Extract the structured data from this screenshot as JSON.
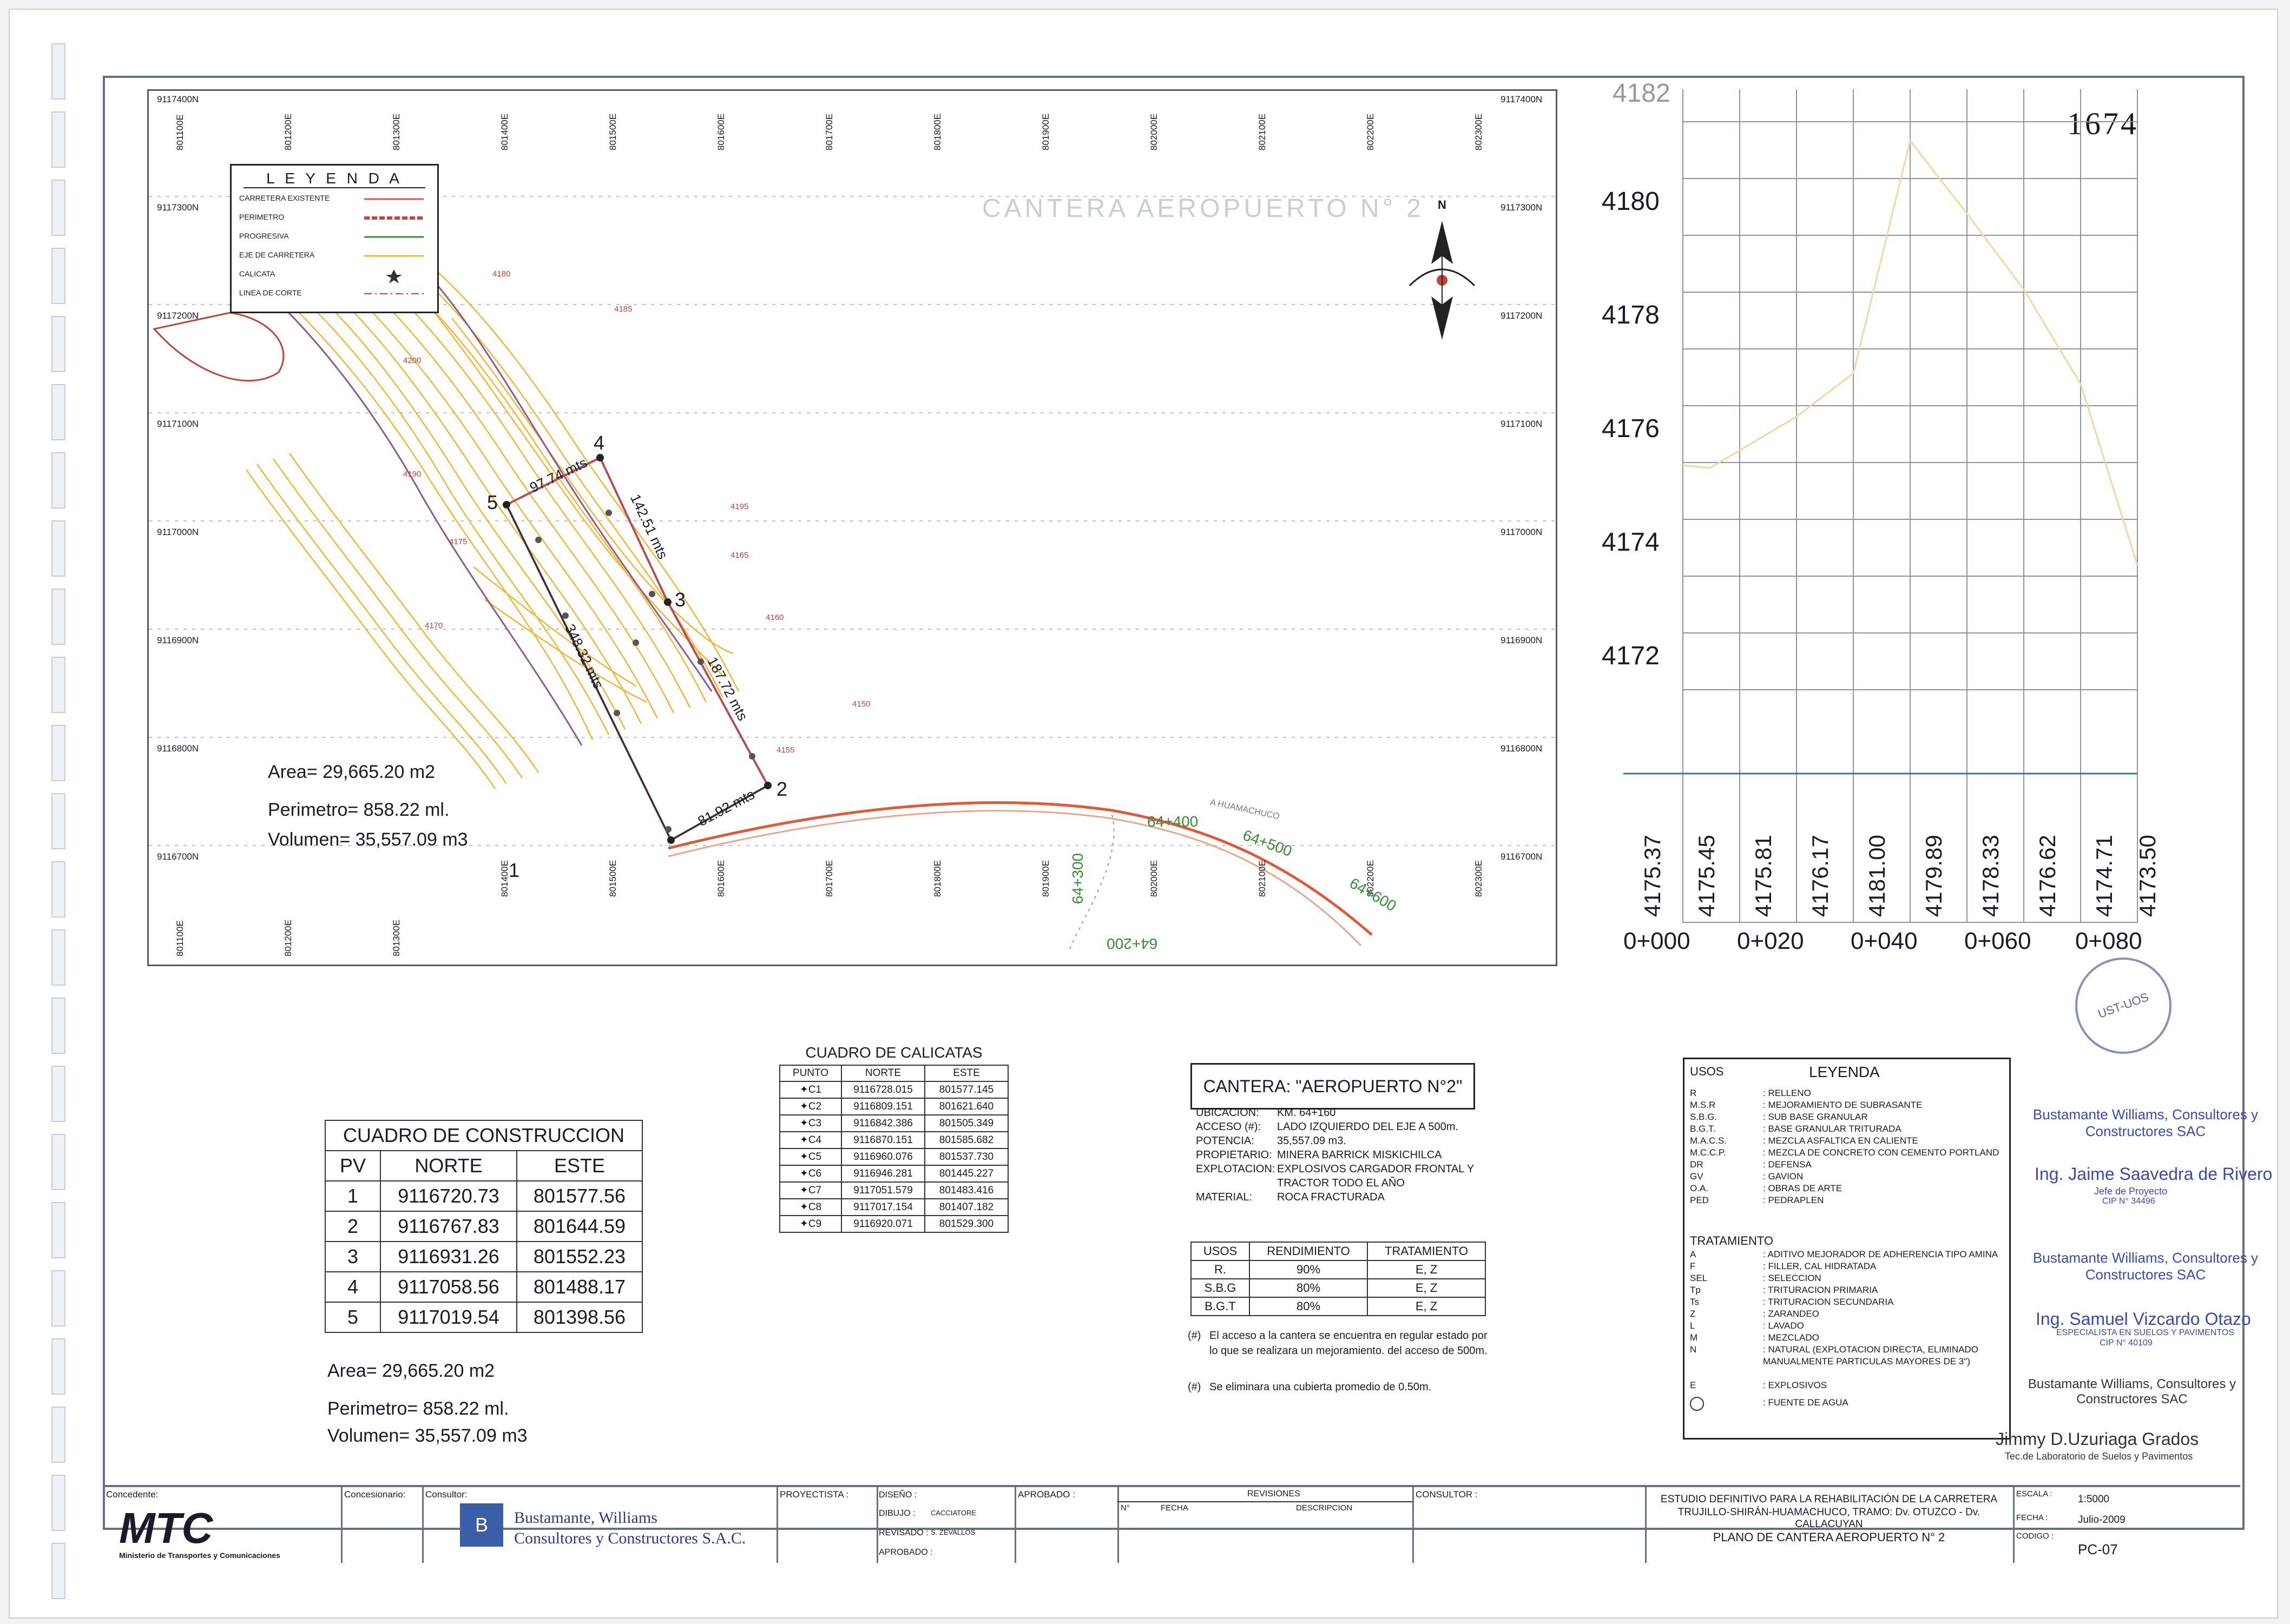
{
  "sheet_number": "1674",
  "map": {
    "title": "CANTERA AEROPUERTO N° 2",
    "north_label": "N",
    "top_coords": [
      "801100E",
      "801200E",
      "801300E",
      "801400E",
      "801500E",
      "801600E",
      "801700E",
      "801800E",
      "801900E",
      "802000E",
      "802100E",
      "802200E",
      "802300E"
    ],
    "bottom_coords": [
      "801100E",
      "801200E",
      "801300E",
      "801400E",
      "801500E",
      "801600E",
      "801700E",
      "801800E",
      "801900E",
      "802000E",
      "802100E",
      "802200E",
      "802300E"
    ],
    "left_coords": [
      "9117400N",
      "9117300N",
      "9117200N",
      "9117100N",
      "9117000N",
      "9116900N",
      "9116800N",
      "9116700N"
    ],
    "right_coords": [
      "9117400N",
      "9117300N",
      "9117200N",
      "9117100N",
      "9117000N",
      "9116900N",
      "9116800N",
      "9116700N"
    ],
    "legend": {
      "title": "L E Y E N D A",
      "items": [
        "CARRETERA EXISTENTE",
        "PERIMETRO",
        "PROGRESIVA",
        "EJE DE CARRETERA",
        "CALICATA",
        "LINEA DE CORTE"
      ]
    },
    "points": [
      "1",
      "2",
      "3",
      "4",
      "5"
    ],
    "distances": [
      "97.74 mts",
      "142.51 mts",
      "348.32 mts",
      "187.72 mts",
      "81.92 mts"
    ],
    "stations": [
      "64+300",
      "64+400",
      "64+500",
      "64+600",
      "64+200"
    ],
    "road_label": "A HUAMACHUCO",
    "contours": [
      "4180",
      "4175",
      "4170",
      "4165",
      "4160",
      "4155",
      "4150",
      "4185",
      "4190",
      "4195",
      "4200"
    ],
    "area": "Area= 29,665.20 m2",
    "perimetro": "Perimetro= 858.22 ml.",
    "volumen": "Volumen= 35,557.09 m3"
  },
  "profile": {
    "top_label": "4182",
    "y_labels": [
      "4180",
      "4178",
      "4176",
      "4174",
      "4172"
    ],
    "elevations": [
      "4175.37",
      "4175.45",
      "4175.81",
      "4176.17",
      "4181.00",
      "4179.89",
      "4178.33",
      "4176.62",
      "4174.71",
      "4173.50"
    ],
    "x_labels": [
      "0+000",
      "0+020",
      "0+040",
      "0+060",
      "0+080"
    ]
  },
  "construccion": {
    "title": "CUADRO DE CONSTRUCCION",
    "headers": [
      "PV",
      "NORTE",
      "ESTE"
    ],
    "rows": [
      [
        "1",
        "9116720.73",
        "801577.56"
      ],
      [
        "2",
        "9116767.83",
        "801644.59"
      ],
      [
        "3",
        "9116931.26",
        "801552.23"
      ],
      [
        "4",
        "9117058.56",
        "801488.17"
      ],
      [
        "5",
        "9117019.54",
        "801398.56"
      ]
    ],
    "area": "Area= 29,665.20 m2",
    "perimetro": "Perimetro= 858.22 ml.",
    "volumen": "Volumen= 35,557.09 m3"
  },
  "calicatas": {
    "title": "CUADRO DE CALICATAS",
    "headers": [
      "PUNTO",
      "NORTE",
      "ESTE"
    ],
    "rows": [
      [
        "C1",
        "9116728.015",
        "801577.145"
      ],
      [
        "C2",
        "9116809.151",
        "801621.640"
      ],
      [
        "C3",
        "9116842.386",
        "801505.349"
      ],
      [
        "C4",
        "9116870.151",
        "801585.682"
      ],
      [
        "C5",
        "9116960.076",
        "801537.730"
      ],
      [
        "C6",
        "9116946.281",
        "801445.227"
      ],
      [
        "C7",
        "9117051.579",
        "801483.416"
      ],
      [
        "C8",
        "9117017.154",
        "801407.182"
      ],
      [
        "C9",
        "9116920.071",
        "801529.300"
      ]
    ]
  },
  "cantera": {
    "title": "CANTERA: \"AEROPUERTO N°2\"",
    "fields": [
      [
        "UBICACION:",
        "KM. 64+160"
      ],
      [
        "ACCESO (#):",
        "LADO IZQUIERDO DEL EJE A 500m."
      ],
      [
        "POTENCIA:",
        "35,557.09 m3."
      ],
      [
        "PROPIETARIO:",
        "MINERA BARRICK MISKICHILCA"
      ],
      [
        "EXPLOTACION:",
        "EXPLOSIVOS CARGADOR FRONTAL Y TRACTOR TODO EL AÑO"
      ],
      [
        "MATERIAL:",
        "ROCA FRACTURADA"
      ]
    ],
    "usos_headers": [
      "USOS",
      "RENDIMIENTO",
      "TRATAMIENTO"
    ],
    "usos_rows": [
      [
        "R.",
        "90%",
        "E, Z"
      ],
      [
        "S.B.G",
        "80%",
        "E, Z"
      ],
      [
        "B.G.T",
        "80%",
        "E, Z"
      ]
    ],
    "note1_sym": "(#)",
    "note1": "El acceso a la cantera se encuentra en regular estado por lo que se realizara un mejoramiento. del acceso de 500m.",
    "note2_sym": "(#)",
    "note2": "Se eliminara una cubierta promedio de 0.50m."
  },
  "leyenda2": {
    "usos_label": "USOS",
    "title": "LEYENDA",
    "usos": [
      [
        "R",
        ": RELLENO"
      ],
      [
        "M.S.R",
        ": MEJORAMIENTO DE SUBRASANTE"
      ],
      [
        "S.B.G.",
        ": SUB BASE GRANULAR"
      ],
      [
        "B.G.T.",
        ": BASE GRANULAR TRITURADA"
      ],
      [
        "M.A.C.S.",
        ": MEZCLA ASFALTICA EN CALIENTE"
      ],
      [
        "M.C.C.P.",
        ": MEZCLA DE CONCRETO CON CEMENTO PORTLAND"
      ],
      [
        "DR",
        ": DEFENSA"
      ],
      [
        "GV",
        ": GAVION"
      ],
      [
        "O.A.",
        ": OBRAS DE ARTE"
      ],
      [
        "PED",
        ": PEDRAPLEN"
      ]
    ],
    "tratamiento_label": "TRATAMIENTO",
    "tratamiento": [
      [
        "A",
        ": ADITIVO MEJORADOR DE ADHERENCIA TIPO AMINA"
      ],
      [
        "F",
        ": FILLER, CAL HIDRATADA"
      ],
      [
        "SEL",
        ": SELECCION"
      ],
      [
        "Tp",
        ": TRITURACION PRIMARIA"
      ],
      [
        "Ts",
        ": TRITURACION SECUNDARIA"
      ],
      [
        "Z",
        ": ZARANDEO"
      ],
      [
        "L",
        ": LAVADO"
      ],
      [
        "M",
        ": MEZCLADO"
      ],
      [
        "N",
        ": NATURAL (EXPLOTACION DIRECTA, ELIMINADO MANUALMENTE PARTICULAS MAYORES DE 3\")"
      ],
      [
        "E",
        ": EXPLOSIVOS"
      ],
      [
        "",
        ": FUENTE DE AGUA"
      ]
    ]
  },
  "stamps": {
    "company": "Bustamante Williams, Consultores y Constructores SAC",
    "eng1_name": "Ing. Jaime Saavedra de Rivero",
    "eng1_role": "Jefe de Proyecto",
    "eng1_cip": "CIP N° 34496",
    "eng2_name": "Ing. Samuel Vizcardo Otazo",
    "eng2_role": "ESPECIALISTA EN SUELOS Y PAVIMENTOS",
    "eng2_cip": "CIP N° 40109",
    "eng3_name": "Jimmy D.Uzuriaga Grados",
    "eng3_role": "Tec.de Laboratorio de Suelos y Pavimentos",
    "seal_text": "UST-UOS"
  },
  "titleblock": {
    "concedente_label": "Concedente:",
    "mtc_logo": "MTC",
    "mtc_sub": "Ministerio de Transportes y Comunicaciones",
    "concesionario_label": "Concesionario:",
    "consultor_label": "Consultor:",
    "consultor_name_1": "Bustamante, Williams",
    "consultor_name_2": "Consultores y Constructores S.A.C.",
    "proyectista_label": "PROYECTISTA :",
    "diseno_label": "DISEÑO :",
    "dibujo_label": "DIBUJO :",
    "dibujo_val": "CACCIATORE",
    "revisado_label": "REVISADO :",
    "revisado_val": "S. ZEVALLOS",
    "aprobado_label": "APROBADO :",
    "aprobado2_label": "APROBADO :",
    "revisiones_label": "REVISIONES",
    "rev_n": "N°",
    "rev_fecha": "FECHA",
    "rev_desc": "DESCRIPCION",
    "consultor2_label": "CONSULTOR :",
    "project_1": "ESTUDIO DEFINITIVO PARA LA REHABILITACIÓN DE LA CARRETERA",
    "project_2": "TRUJILLO-SHIRÁN-HUAMACHUCO, TRAMO: Dv. OTUZCO - Dv. CALLACUYAN",
    "plan_title": "PLANO DE CANTERA AEROPUERTO N° 2",
    "escala_label": "ESCALA :",
    "escala_val": "1:5000",
    "fecha_label": "FECHA :",
    "fecha_val": "Julio-2009",
    "codigo_label": "CODIGO :",
    "codigo_val": "PC-07"
  }
}
